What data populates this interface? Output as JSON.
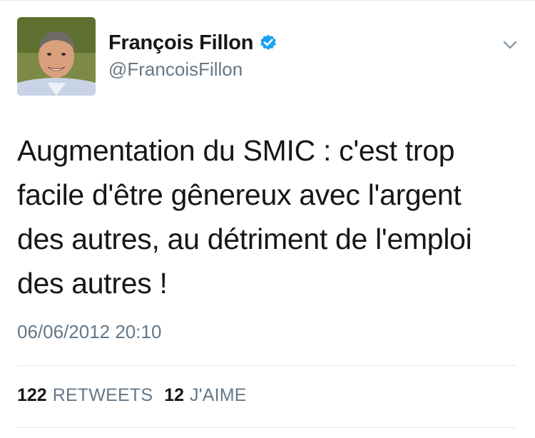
{
  "author": {
    "display_name": "François Fillon",
    "handle": "@FrancoisFillon",
    "verified": true,
    "avatar_icon": "profile-photo"
  },
  "tweet": {
    "text": "Augmentation du SMIC : c'est trop\nfacile d'être gênereux avec l'argent\ndes autres, au détriment de l'emploi\ndes autres !",
    "timestamp": "06/06/2012 20:10"
  },
  "stats": {
    "retweets_count": "122",
    "retweets_label": "RETWEETS",
    "likes_count": "12",
    "likes_label": "J'AIME"
  },
  "colors": {
    "verified_blue": "#1da1f2",
    "secondary_text": "#657786",
    "primary_text": "#14171a",
    "divider": "#e1e8ed"
  },
  "icons": {
    "verified": "verified-badge-icon",
    "menu": "chevron-down-icon"
  }
}
